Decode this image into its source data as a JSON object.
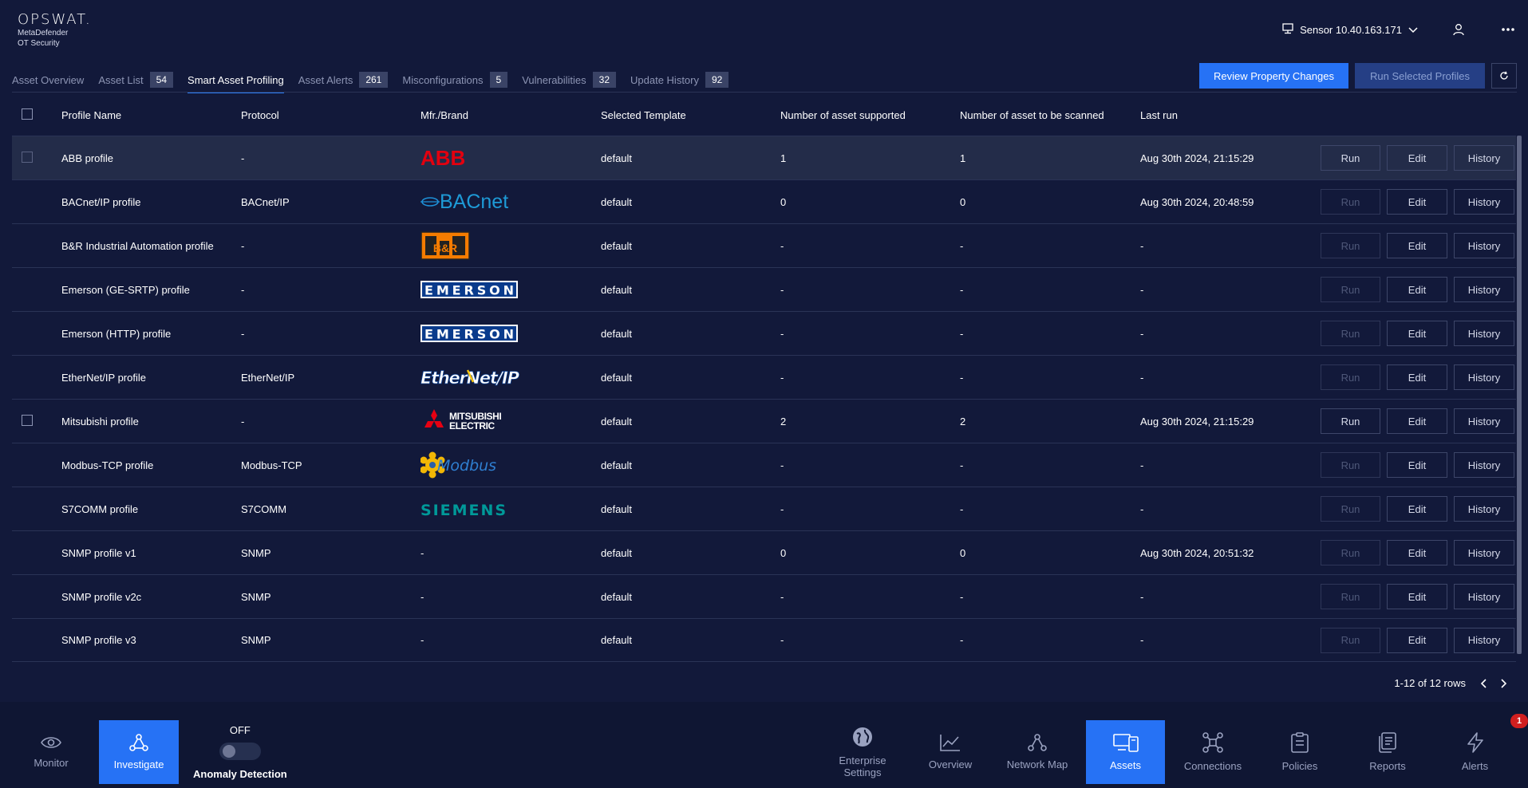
{
  "header": {
    "logo": "OPSWAT.",
    "product_line1": "MetaDefender",
    "product_line2": "OT Security",
    "sensor_label": "Sensor 10.40.163.171"
  },
  "tabs": [
    {
      "label": "Asset Overview",
      "badge": ""
    },
    {
      "label": "Asset List",
      "badge": "54"
    },
    {
      "label": "Smart Asset Profiling",
      "badge": "",
      "active": true
    },
    {
      "label": "Asset Alerts",
      "badge": "261"
    },
    {
      "label": "Misconfigurations",
      "badge": "5"
    },
    {
      "label": "Vulnerabilities",
      "badge": "32"
    },
    {
      "label": "Update History",
      "badge": "92"
    }
  ],
  "actions": {
    "review": "Review Property Changes",
    "run_selected": "Run Selected Profiles"
  },
  "table": {
    "headers": {
      "name": "Profile Name",
      "protocol": "Protocol",
      "brand": "Mfr./Brand",
      "template": "Selected Template",
      "supported": "Number of asset supported",
      "scanned": "Number of asset to be scanned",
      "last_run": "Last run"
    },
    "buttons": {
      "run": "Run",
      "edit": "Edit",
      "history": "History"
    },
    "rows": [
      {
        "name": "ABB profile",
        "protocol": "-",
        "brand_logo": "ABB",
        "template": "default",
        "supported": "1",
        "scanned": "1",
        "last_run": "Aug 30th 2024, 21:15:29"
      },
      {
        "name": "BACnet/IP profile",
        "protocol": "BACnet/IP",
        "brand_logo": "BACnet",
        "template": "default",
        "supported": "0",
        "scanned": "0",
        "last_run": "Aug 30th 2024, 20:48:59"
      },
      {
        "name": "B&R Industrial Automation profile",
        "protocol": "-",
        "brand_logo": "B&R",
        "template": "default",
        "supported": "-",
        "scanned": "-",
        "last_run": "-"
      },
      {
        "name": "Emerson (GE-SRTP) profile",
        "protocol": "-",
        "brand_logo": "EMERSON",
        "template": "default",
        "supported": "-",
        "scanned": "-",
        "last_run": "-"
      },
      {
        "name": "Emerson (HTTP) profile",
        "protocol": "-",
        "brand_logo": "EMERSON",
        "template": "default",
        "supported": "-",
        "scanned": "-",
        "last_run": "-"
      },
      {
        "name": "EtherNet/IP profile",
        "protocol": "EtherNet/IP",
        "brand_logo": "EtherNet/IP",
        "template": "default",
        "supported": "-",
        "scanned": "-",
        "last_run": "-"
      },
      {
        "name": "Mitsubishi profile",
        "protocol": "-",
        "brand_logo": "MITSUBISHI ELECTRIC",
        "template": "default",
        "supported": "2",
        "scanned": "2",
        "last_run": "Aug 30th 2024, 21:15:29"
      },
      {
        "name": "Modbus-TCP profile",
        "protocol": "Modbus-TCP",
        "brand_logo": "Modbus",
        "template": "default",
        "supported": "-",
        "scanned": "-",
        "last_run": "-"
      },
      {
        "name": "S7COMM profile",
        "protocol": "S7COMM",
        "brand_logo": "SIEMENS",
        "template": "default",
        "supported": "-",
        "scanned": "-",
        "last_run": "-"
      },
      {
        "name": "SNMP profile v1",
        "protocol": "SNMP",
        "brand_text": "-",
        "template": "default",
        "supported": "0",
        "scanned": "0",
        "last_run": "Aug 30th 2024, 20:51:32"
      },
      {
        "name": "SNMP profile v2c",
        "protocol": "SNMP",
        "brand_text": "-",
        "template": "default",
        "supported": "-",
        "scanned": "-",
        "last_run": "-"
      },
      {
        "name": "SNMP profile v3",
        "protocol": "SNMP",
        "brand_text": "-",
        "template": "default",
        "supported": "-",
        "scanned": "-",
        "last_run": "-"
      }
    ]
  },
  "pagination": {
    "summary": "1-12 of 12 rows"
  },
  "footer": {
    "monitor": "Monitor",
    "investigate": "Investigate",
    "anomaly_state": "OFF",
    "anomaly_label": "Anomaly Detection",
    "enterprise_1": "Enterprise",
    "enterprise_2": "Settings",
    "overview": "Overview",
    "network_map": "Network Map",
    "assets": "Assets",
    "connections": "Connections",
    "policies": "Policies",
    "reports": "Reports",
    "alerts": "Alerts",
    "alerts_count": "1"
  },
  "colors": {
    "background": "#12193a",
    "accent": "#2672f5",
    "alert": "#d11f1f"
  }
}
